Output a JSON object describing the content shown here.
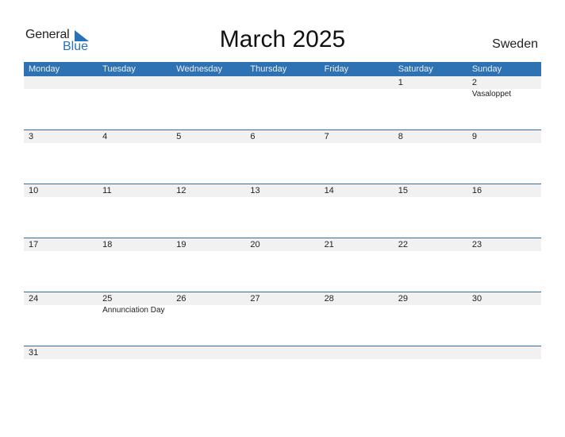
{
  "logo": {
    "word1": "General",
    "word2": "Blue"
  },
  "title": "March 2025",
  "country": "Sweden",
  "colors": {
    "header_bg": "#2f72b3",
    "accent": "#2a72b8",
    "row_strip": "#f1f1f1"
  },
  "weekdays": [
    "Monday",
    "Tuesday",
    "Wednesday",
    "Thursday",
    "Friday",
    "Saturday",
    "Sunday"
  ],
  "weeks": [
    [
      {
        "day": "",
        "event": ""
      },
      {
        "day": "",
        "event": ""
      },
      {
        "day": "",
        "event": ""
      },
      {
        "day": "",
        "event": ""
      },
      {
        "day": "",
        "event": ""
      },
      {
        "day": "1",
        "event": ""
      },
      {
        "day": "2",
        "event": "Vasaloppet"
      }
    ],
    [
      {
        "day": "3",
        "event": ""
      },
      {
        "day": "4",
        "event": ""
      },
      {
        "day": "5",
        "event": ""
      },
      {
        "day": "6",
        "event": ""
      },
      {
        "day": "7",
        "event": ""
      },
      {
        "day": "8",
        "event": ""
      },
      {
        "day": "9",
        "event": ""
      }
    ],
    [
      {
        "day": "10",
        "event": ""
      },
      {
        "day": "11",
        "event": ""
      },
      {
        "day": "12",
        "event": ""
      },
      {
        "day": "13",
        "event": ""
      },
      {
        "day": "14",
        "event": ""
      },
      {
        "day": "15",
        "event": ""
      },
      {
        "day": "16",
        "event": ""
      }
    ],
    [
      {
        "day": "17",
        "event": ""
      },
      {
        "day": "18",
        "event": ""
      },
      {
        "day": "19",
        "event": ""
      },
      {
        "day": "20",
        "event": ""
      },
      {
        "day": "21",
        "event": ""
      },
      {
        "day": "22",
        "event": ""
      },
      {
        "day": "23",
        "event": ""
      }
    ],
    [
      {
        "day": "24",
        "event": ""
      },
      {
        "day": "25",
        "event": "Annunciation Day"
      },
      {
        "day": "26",
        "event": ""
      },
      {
        "day": "27",
        "event": ""
      },
      {
        "day": "28",
        "event": ""
      },
      {
        "day": "29",
        "event": ""
      },
      {
        "day": "30",
        "event": ""
      }
    ],
    [
      {
        "day": "31",
        "event": ""
      },
      {
        "day": "",
        "event": ""
      },
      {
        "day": "",
        "event": ""
      },
      {
        "day": "",
        "event": ""
      },
      {
        "day": "",
        "event": ""
      },
      {
        "day": "",
        "event": ""
      },
      {
        "day": "",
        "event": ""
      }
    ]
  ]
}
